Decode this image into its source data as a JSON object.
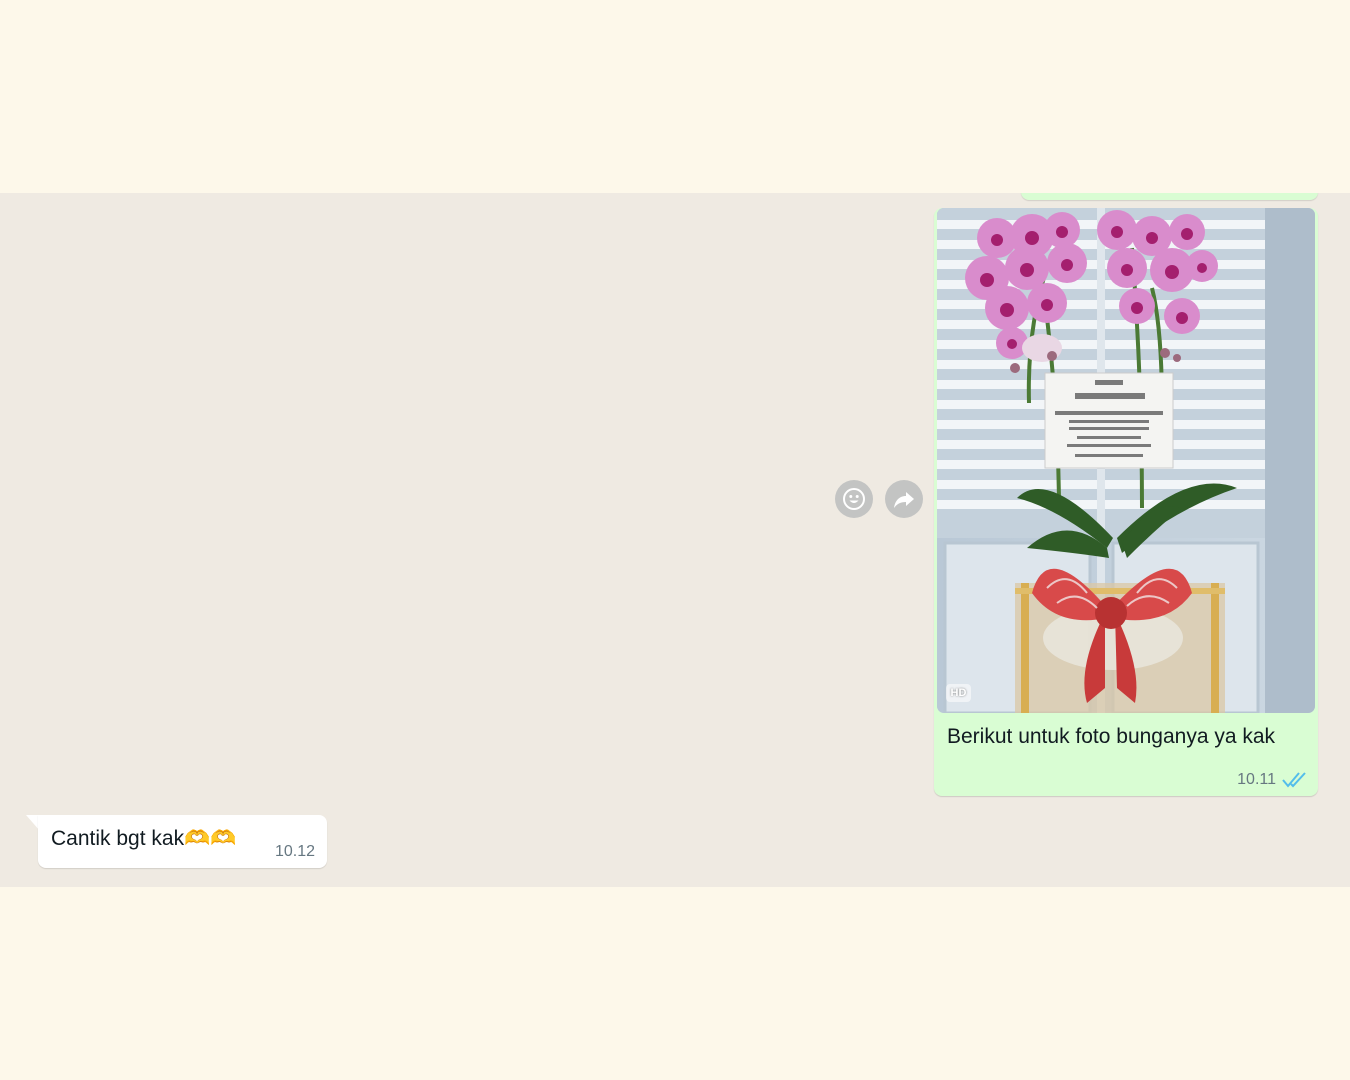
{
  "messages": {
    "outgoing": {
      "hd_badge": "HD",
      "caption": "Berikut untuk foto bunganya ya kak",
      "time": "10.11",
      "status": "read"
    },
    "incoming": {
      "text": "Cantik bgt kak🫶🫶",
      "time": "10.12"
    }
  },
  "actions": {
    "react_icon": "emoji-icon",
    "forward_icon": "forward-icon"
  },
  "colors": {
    "outgoing_bubble": "#d9fdd3",
    "incoming_bubble": "#ffffff",
    "chat_background": "#efeae2",
    "page_background": "#fdf8ea",
    "read_ticks": "#53bdeb"
  }
}
